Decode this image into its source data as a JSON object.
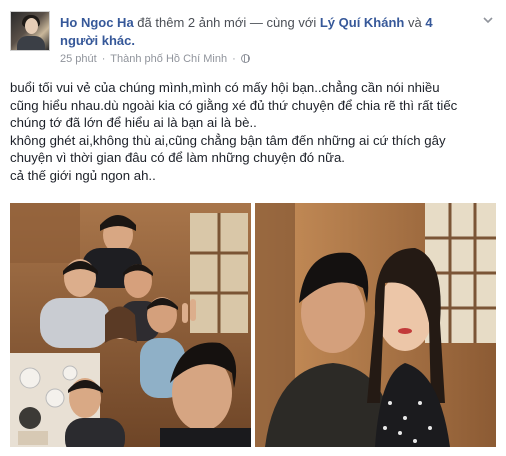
{
  "post": {
    "author": "Ho Ngoc Ha",
    "action_text": "đã thêm 2 ảnh mới",
    "with_text": "— cùng với",
    "tagged_person": "Lý Quí Khánh",
    "and_text": "và",
    "others_line1": "4",
    "others_line2": "người khác.",
    "time": "25 phút",
    "dot": "·",
    "location": "Thành phố Hồ Chí Minh",
    "dot2": "·",
    "privacy_icon": "globe-icon",
    "menu_icon": "chevron-down-icon",
    "lines": [
      "buổi tối vui vẻ của chúng mình,mình có mấy hội bạn..chẳng cần nói nhiều",
      "cũng hiểu nhau.dù ngoài kia có giằng xé đủ thứ chuyện để chia rẽ thì rất tiếc",
      "chúng tớ đã lớn để hiểu ai là bạn ai là bè..",
      "không ghét ai,không thù ai,cũng chẳng bận tâm đến những ai cứ thích gây",
      "chuyện vì thời gian đâu có để làm những chuyện đó nữa.",
      "cả thế giới ngủ ngon ah.."
    ]
  },
  "colors": {
    "link": "#365899",
    "meta": "#90949c",
    "text": "#1d2129"
  }
}
